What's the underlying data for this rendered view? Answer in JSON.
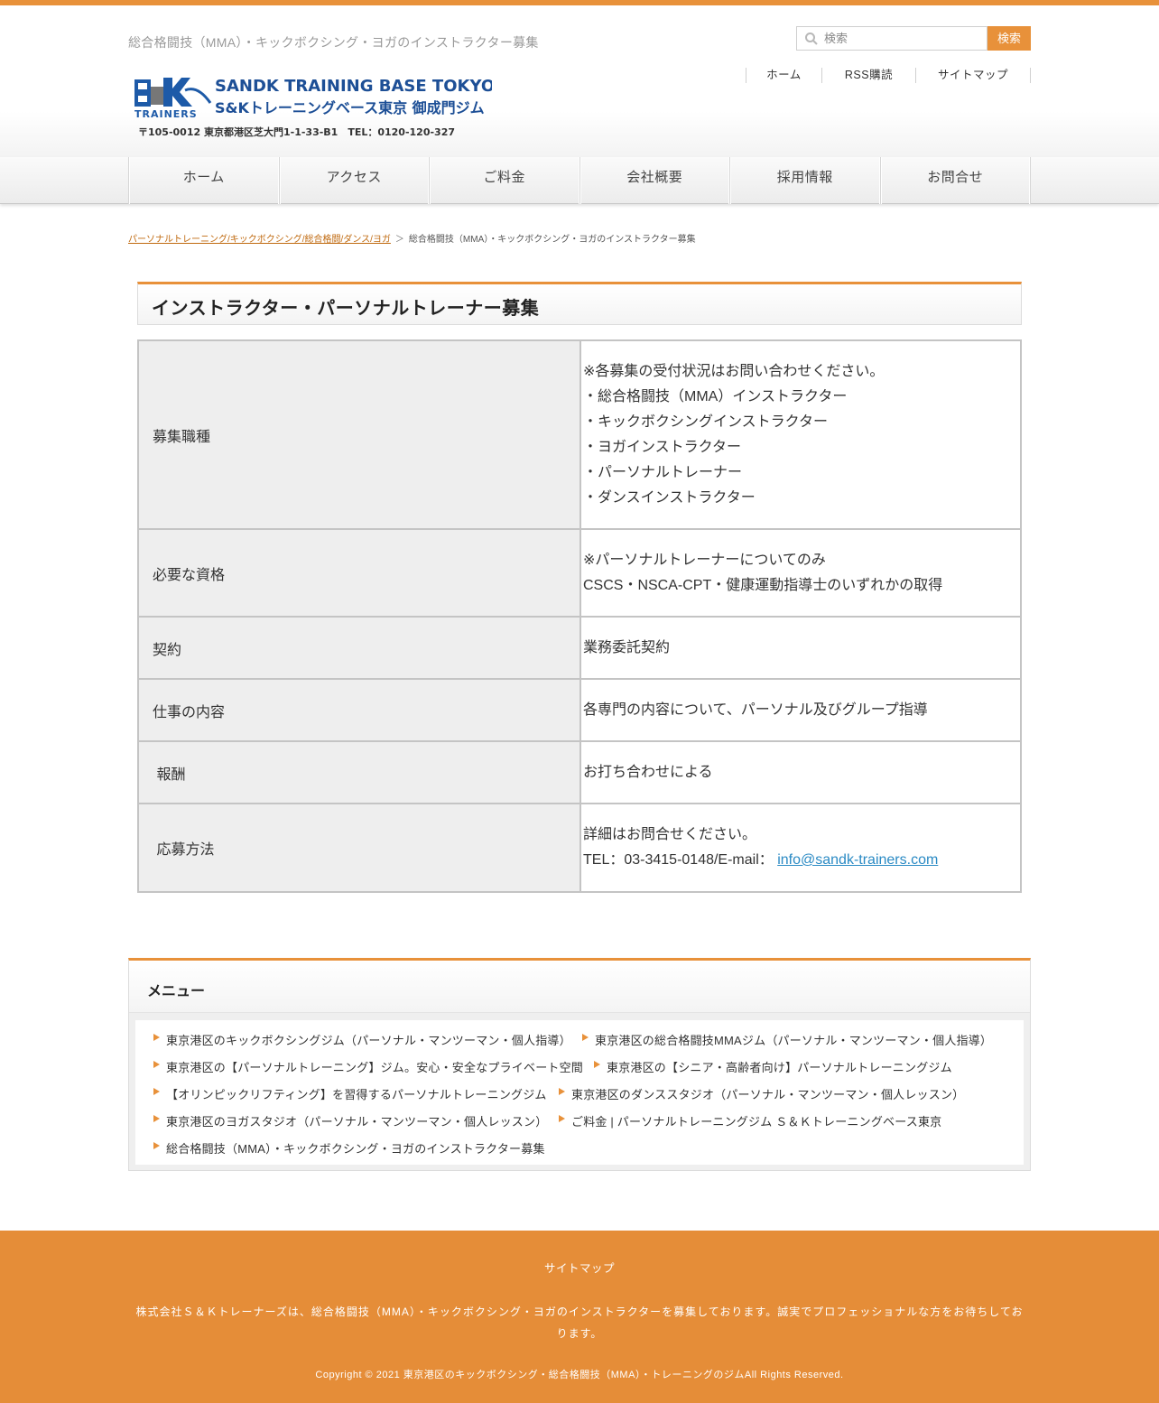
{
  "header": {
    "tagline": "総合格闘技（MMA）・キックボクシング・ヨガのインストラクター募集",
    "search": {
      "placeholder": "検索",
      "button": "検索"
    },
    "util_nav": [
      "ホーム",
      "RSS購読",
      "サイトマップ"
    ],
    "logo": {
      "brand_mark": "S&K TRAINERS",
      "line1": "SANDK TRAINING BASE TOKYO",
      "line2": "S&Kトレーニングベース東京 御成門ジム",
      "address": "〒105-0012 東京都港区芝大門1-1-33-B1　TEL：0120-120-327"
    }
  },
  "nav": [
    "ホーム",
    "アクセス",
    "ご料金",
    "会社概要",
    "採用情報",
    "お問合せ"
  ],
  "breadcrumb": {
    "home": "パーソナルトレーニング/キックボクシング/総合格闘/ダンス/ヨガ",
    "separator": "＞",
    "current": "総合格闘技（MMA）・キックボクシング・ヨガのインストラクター募集"
  },
  "page_title": "インストラクター・パーソナルトレーナー募集",
  "recruit_table": [
    {
      "label": "募集職種",
      "lines": [
        "※各募集の受付状況はお問い合わせください。",
        "・総合格闘技（MMA）インストラクター",
        "・キックボクシングインストラクター",
        "・ヨガインストラクター",
        "・パーソナルトレーナー",
        "・ダンスインストラクター"
      ]
    },
    {
      "label": "必要な資格",
      "lines": [
        "※パーソナルトレーナーについてのみ",
        "CSCS・NSCA-CPT・健康運動指導士のいずれかの取得"
      ]
    },
    {
      "label": "契約",
      "lines": [
        "業務委託契約"
      ]
    },
    {
      "label": "仕事の内容",
      "lines": [
        "各専門の内容について、パーソナル及びグループ指導"
      ]
    },
    {
      "label": " 報酬",
      "lines": [
        "お打ち合わせによる"
      ]
    },
    {
      "label": " 応募方法",
      "lines": [
        "詳細はお問合せください。"
      ],
      "contact_prefix": "TEL：03-3415-0148/E-mail： ",
      "email": "info@sandk-trainers.com"
    }
  ],
  "menu": {
    "title": "メニュー",
    "links": [
      "東京港区のキックボクシングジム（パーソナル・マンツーマン・個人指導）",
      "東京港区の総合格闘技MMAジム（パーソナル・マンツーマン・個人指導）",
      "東京港区の【パーソナルトレーニング】ジム。安心・安全なプライベート空間",
      "東京港区の【シニア・高齢者向け】パーソナルトレーニングジム",
      "【オリンピックリフティング】を習得するパーソナルトレーニングジム",
      "東京港区のダンススタジオ（パーソナル・マンツーマン・個人レッスン）",
      "東京港区のヨガスタジオ（パーソナル・マンツーマン・個人レッスン）",
      "ご料金 | パーソナルトレーニングジム Ｓ＆Ｋトレーニングベース東京",
      "総合格闘技（MMA）・キックボクシング・ヨガのインストラクター募集"
    ]
  },
  "footer": {
    "sitemap": "サイトマップ",
    "description": "株式会社Ｓ＆Ｋトレーナーズは、総合格闘技（MMA）・キックボクシング・ヨガのインストラクターを募集しております。誠実でプロフェッショナルな方をお待ちしております。",
    "copyright": "Copyright © 2021 東京港区のキックボクシング・総合格闘技（MMA）・トレーニングのジムAll Rights Reserved."
  },
  "colors": {
    "accent": "#e8913a",
    "link": "#2a8ac4",
    "breadcrumb_link": "#c06a10"
  }
}
